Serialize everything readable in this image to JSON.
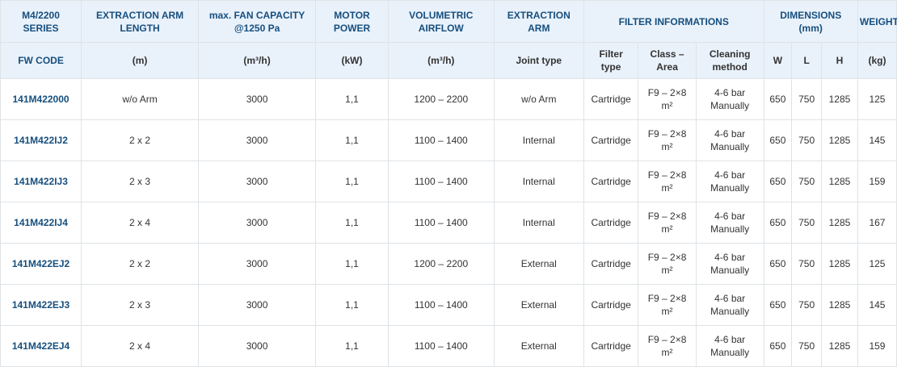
{
  "header_row1": {
    "series": [
      "M4/2200",
      "SERIES"
    ],
    "arm_length": [
      "EXTRACTION ARM",
      "LENGTH"
    ],
    "fan_capacity": [
      "max. FAN CAPACITY",
      "@1250 Pa"
    ],
    "motor_power": [
      "MOTOR",
      "POWER"
    ],
    "airflow": [
      "VOLUMETRIC",
      "AIRFLOW"
    ],
    "extraction_arm": [
      "EXTRACTION",
      "ARM"
    ],
    "filter_info": "FILTER INFORMATIONS",
    "dimensions": [
      "DIMENSIONS",
      "(mm)"
    ],
    "weight": "WEIGHT"
  },
  "header_row2": {
    "fw_code": "FW CODE",
    "arm_length_unit": "(m)",
    "fan_capacity_unit": "(m³/h)",
    "motor_power_unit": "(kW)",
    "airflow_unit": "(m³/h)",
    "joint_type": "Joint type",
    "filter_type": [
      "Filter",
      "type"
    ],
    "class_area": [
      "Class –",
      "Area"
    ],
    "cleaning_method": [
      "Cleaning",
      "method"
    ],
    "w": "W",
    "l": "L",
    "h": "H",
    "weight_unit": "(kg)"
  },
  "rows": [
    {
      "code": "141M422000",
      "arm": "w/o Arm",
      "fan": "3000",
      "power": "1,1",
      "airflow": "1200 – 2200",
      "joint": "w/o Arm",
      "filter": "Cartridge",
      "class_area": [
        "F9 – 2×8",
        "m²"
      ],
      "cleaning": [
        "4-6 bar",
        "Manually"
      ],
      "w": "650",
      "l": "750",
      "h": "1285",
      "weight": "125"
    },
    {
      "code": "141M422IJ2",
      "arm": "2 x 2",
      "fan": "3000",
      "power": "1,1",
      "airflow": "1100 – 1400",
      "joint": "Internal",
      "filter": "Cartridge",
      "class_area": [
        "F9 – 2×8",
        "m²"
      ],
      "cleaning": [
        "4-6 bar",
        "Manually"
      ],
      "w": "650",
      "l": "750",
      "h": "1285",
      "weight": "145"
    },
    {
      "code": "141M422IJ3",
      "arm": "2 x 3",
      "fan": "3000",
      "power": "1,1",
      "airflow": "1100 – 1400",
      "joint": "Internal",
      "filter": "Cartridge",
      "class_area": [
        "F9 – 2×8",
        "m²"
      ],
      "cleaning": [
        "4-6 bar",
        "Manually"
      ],
      "w": "650",
      "l": "750",
      "h": "1285",
      "weight": "159"
    },
    {
      "code": "141M422IJ4",
      "arm": "2 x 4",
      "fan": "3000",
      "power": "1,1",
      "airflow": "1100 – 1400",
      "joint": "Internal",
      "filter": "Cartridge",
      "class_area": [
        "F9 – 2×8",
        "m²"
      ],
      "cleaning": [
        "4-6 bar",
        "Manually"
      ],
      "w": "650",
      "l": "750",
      "h": "1285",
      "weight": "167"
    },
    {
      "code": "141M422EJ2",
      "arm": "2 x 2",
      "fan": "3000",
      "power": "1,1",
      "airflow": "1200 – 2200",
      "joint": "External",
      "filter": "Cartridge",
      "class_area": [
        "F9 – 2×8",
        "m²"
      ],
      "cleaning": [
        "4-6 bar",
        "Manually"
      ],
      "w": "650",
      "l": "750",
      "h": "1285",
      "weight": "125"
    },
    {
      "code": "141M422EJ3",
      "arm": "2 x 3",
      "fan": "3000",
      "power": "1,1",
      "airflow": "1100 – 1400",
      "joint": "External",
      "filter": "Cartridge",
      "class_area": [
        "F9 – 2×8",
        "m²"
      ],
      "cleaning": [
        "4-6 bar",
        "Manually"
      ],
      "w": "650",
      "l": "750",
      "h": "1285",
      "weight": "145"
    },
    {
      "code": "141M422EJ4",
      "arm": "2 x 4",
      "fan": "3000",
      "power": "1,1",
      "airflow": "1100 – 1400",
      "joint": "External",
      "filter": "Cartridge",
      "class_area": [
        "F9 – 2×8",
        "m²"
      ],
      "cleaning": [
        "4-6 bar",
        "Manually"
      ],
      "w": "650",
      "l": "750",
      "h": "1285",
      "weight": "159"
    }
  ],
  "colors": {
    "header_bg": "#e9f1fa",
    "header_text": "#164f7e",
    "code_text": "#164f7e",
    "border": "#dfe3e6",
    "body_text": "#333333"
  }
}
